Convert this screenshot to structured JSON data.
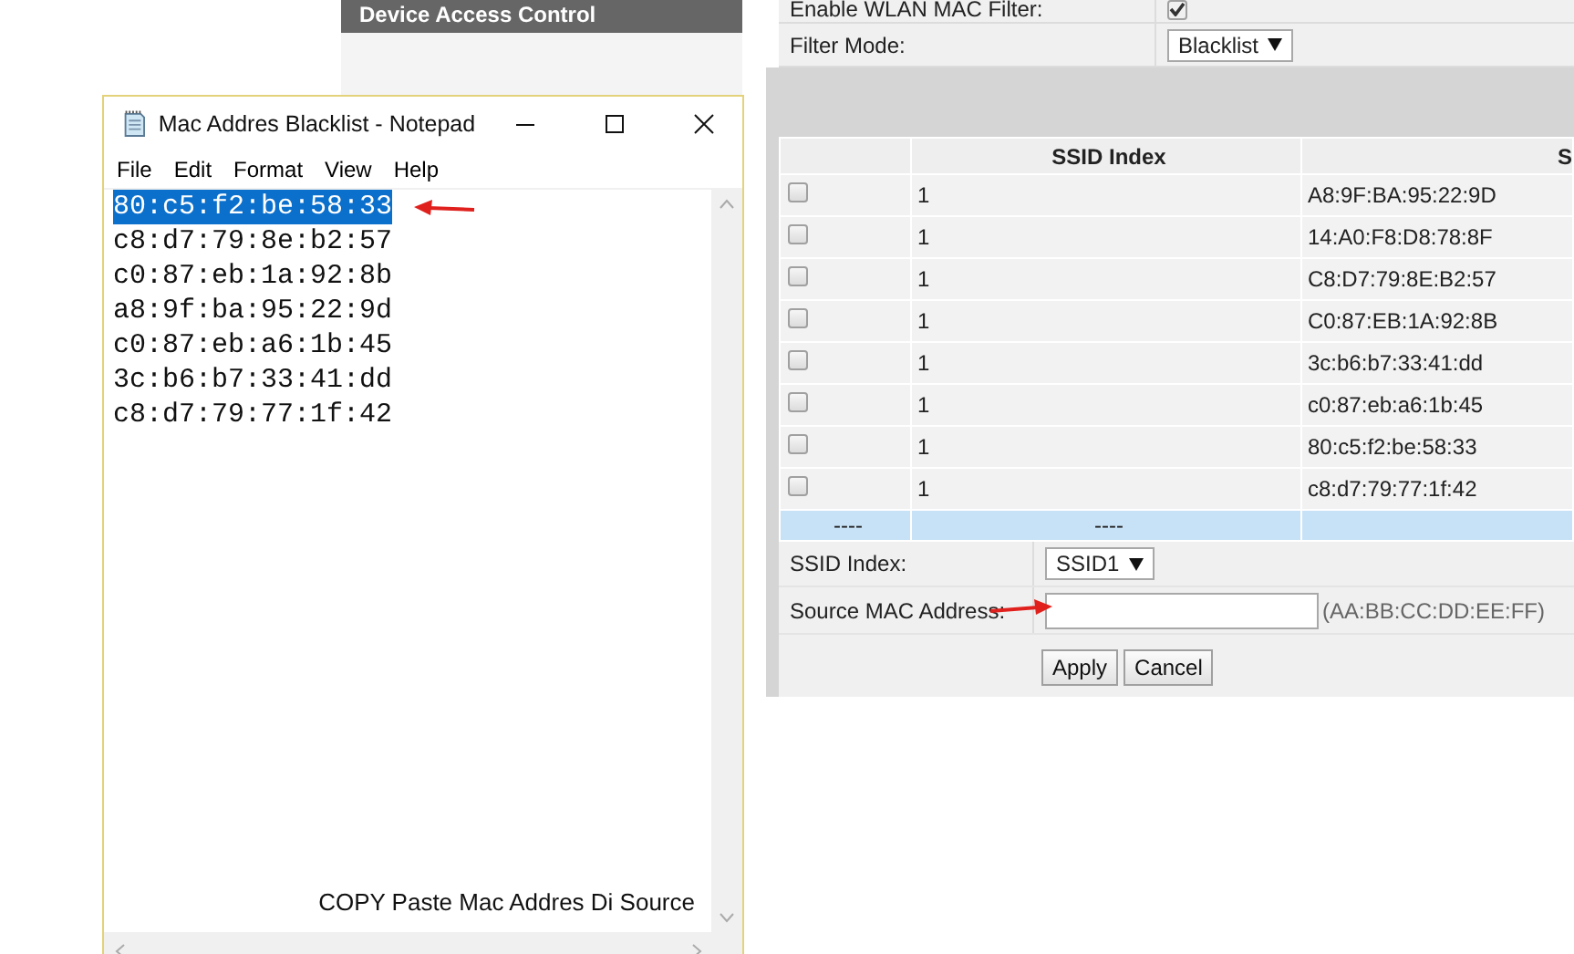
{
  "router": {
    "sidebar": {
      "header": "Device Access Control"
    },
    "filter": {
      "enable_label": "Enable WLAN MAC Filter:",
      "enable_checked": true,
      "mode_label": "Filter Mode:",
      "mode_value": "Blacklist"
    },
    "table": {
      "columns": [
        "SSID Index",
        "S"
      ],
      "rows": [
        {
          "checked": false,
          "ssid_index": "1",
          "mac": "A8:9F:BA:95:22:9D"
        },
        {
          "checked": false,
          "ssid_index": "1",
          "mac": "14:A0:F8:D8:78:8F"
        },
        {
          "checked": false,
          "ssid_index": "1",
          "mac": "C8:D7:79:8E:B2:57"
        },
        {
          "checked": false,
          "ssid_index": "1",
          "mac": "C0:87:EB:1A:92:8B"
        },
        {
          "checked": false,
          "ssid_index": "1",
          "mac": "3c:b6:b7:33:41:dd"
        },
        {
          "checked": false,
          "ssid_index": "1",
          "mac": "c0:87:eb:a6:1b:45"
        },
        {
          "checked": false,
          "ssid_index": "1",
          "mac": "80:c5:f2:be:58:33"
        },
        {
          "checked": false,
          "ssid_index": "1",
          "mac": "c8:d7:79:77:1f:42"
        }
      ],
      "new_row": [
        "----",
        "----"
      ]
    },
    "form": {
      "ssid_label": "SSID Index:",
      "ssid_value": "SSID1",
      "mac_label": "Source MAC Address:",
      "mac_hint": "(AA:BB:CC:DD:EE:FF)"
    },
    "buttons": [
      "Apply",
      "Cancel"
    ]
  },
  "notepad": {
    "title": "Mac Addres Blacklist - Notepad",
    "menu": [
      "File",
      "Edit",
      "Format",
      "View",
      "Help"
    ],
    "lines": [
      {
        "text": "80:c5:f2:be:58:33",
        "selected": true
      },
      {
        "text": "c8:d7:79:8e:b2:57",
        "selected": false
      },
      {
        "text": "c0:87:eb:1a:92:8b",
        "selected": false
      },
      {
        "text": "a8:9f:ba:95:22:9d",
        "selected": false
      },
      {
        "text": "c0:87:eb:a6:1b:45",
        "selected": false
      },
      {
        "text": "3c:b6:b7:33:41:dd",
        "selected": false
      },
      {
        "text": "c8:d7:79:77:1f:42",
        "selected": false
      }
    ],
    "caption": "COPY Paste Mac Addres Di Source"
  }
}
